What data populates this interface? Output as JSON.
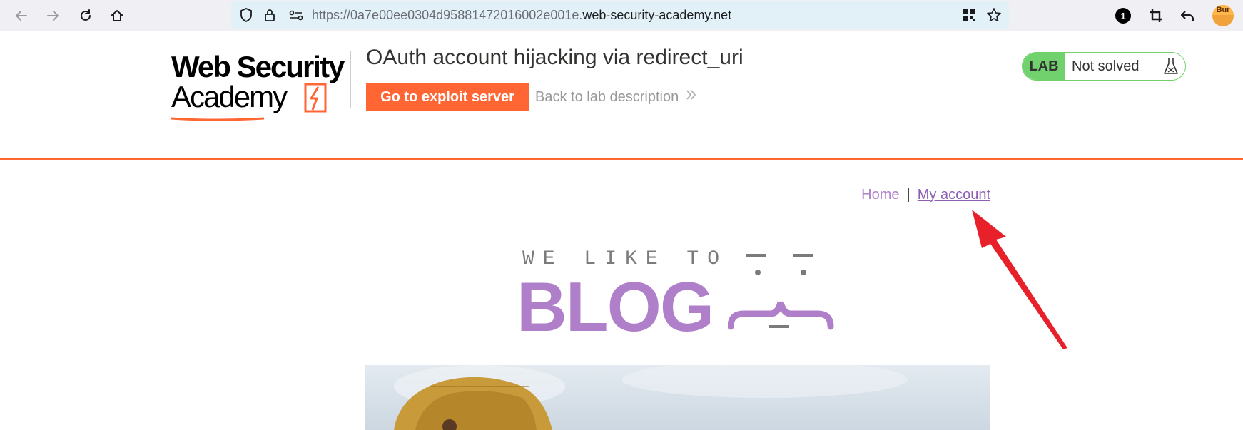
{
  "browser": {
    "url_prefix": "https://0a7e00ee0304d95881472016002e001e.",
    "url_domain": "web-security-academy.net",
    "notification_count": "1",
    "extension_label": "Bur"
  },
  "header": {
    "logo_line1": "Web Security",
    "logo_line2": "Academy",
    "lab_title": "OAuth account hijacking via redirect_uri",
    "exploit_button": "Go to exploit server",
    "back_link": "Back to lab description",
    "lab_badge": "LAB",
    "lab_status": "Not solved"
  },
  "nav": {
    "home": "Home",
    "separator": "|",
    "my_account": "My account"
  },
  "banner": {
    "small_text": "WE LIKE TO",
    "big_text": "BLOG"
  },
  "colors": {
    "accent_orange": "#ff6633",
    "blog_purple": "#b07fca",
    "lab_green": "#70d16d",
    "annotation_red": "#e8202a"
  }
}
